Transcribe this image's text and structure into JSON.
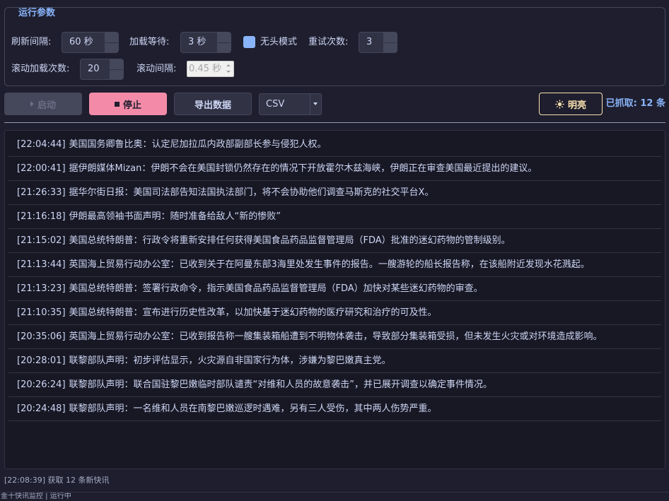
{
  "params": {
    "title": "运行参数",
    "refresh_interval": {
      "label": "刷新间隔:",
      "value": "60 秒"
    },
    "load_wait": {
      "label": "加载等待:",
      "value": "3 秒"
    },
    "headless": {
      "label": "无头模式",
      "checked": true
    },
    "retry_count": {
      "label": "重试次数:",
      "value": "3"
    },
    "scroll_load_count": {
      "label": "滚动加载次数:",
      "value": "20"
    },
    "scroll_interval": {
      "label": "滚动间隔:",
      "value": "0.45 秒",
      "enabled": false
    }
  },
  "toolbar": {
    "start": {
      "label": "启动",
      "icon": "play-icon",
      "enabled": false
    },
    "stop": {
      "label": "停止",
      "icon": "stop-icon",
      "enabled": true
    },
    "export": {
      "label": "导出数据",
      "enabled": true
    },
    "format": {
      "selected": "CSV",
      "icon": "chevron-down-icon"
    },
    "theme": {
      "label": "明亮",
      "icon": "sun-icon"
    },
    "count_label": "已抓取: 12 条"
  },
  "log": {
    "entries": [
      {
        "time": "[22:04:44]",
        "text": "美国国务卿鲁比奥：认定尼加拉瓜内政部副部长参与侵犯人权。"
      },
      {
        "time": "[22:00:41]",
        "text": "据伊朗媒体Mizan：伊朗不会在美国封锁仍然存在的情况下开放霍尔木兹海峡，伊朗正在审查美国最近提出的建议。"
      },
      {
        "time": "[21:26:33]",
        "text": "据华尔街日报：美国司法部告知法国执法部门，将不会协助他们调查马斯克的社交平台X。"
      },
      {
        "time": "[21:16:18]",
        "text": "伊朗最高领袖书面声明：随时准备给敌人“新的惨败”"
      },
      {
        "time": "[21:15:02]",
        "text": "美国总统特朗普：行政令将重新安排任何获得美国食品药品监督管理局（FDA）批准的迷幻药物的管制级别。"
      },
      {
        "time": "[21:13:44]",
        "text": "英国海上贸易行动办公室：已收到关于在阿曼东部3海里处发生事件的报告。一艘游轮的船长报告称，在该船附近发现水花溅起。"
      },
      {
        "time": "[21:13:23]",
        "text": "美国总统特朗普：签署行政命令，指示美国食品药品监督管理局（FDA）加快对某些迷幻药物的审查。"
      },
      {
        "time": "[21:10:35]",
        "text": "美国总统特朗普：宣布进行历史性改革，以加快基于迷幻药物的医疗研究和治疗的可及性。"
      },
      {
        "time": "[20:35:06]",
        "text": "英国海上贸易行动办公室：已收到报告称一艘集装箱船遭到不明物体袭击，导致部分集装箱受损，但未发生火灾或对环境造成影响。"
      },
      {
        "time": "[20:28:01]",
        "text": "联黎部队声明：初步评估显示，火灾源自非国家行为体，涉嫌为黎巴嫩真主党。"
      },
      {
        "time": "[20:26:24]",
        "text": "联黎部队声明：联合国驻黎巴嫩临时部队谴责“对维和人员的故意袭击”，并已展开调查以确定事件情况。"
      },
      {
        "time": "[20:24:48]",
        "text": "联黎部队声明：一名维和人员在南黎巴嫩巡逻时遇难，另有三人受伤，其中两人伤势严重。"
      }
    ]
  },
  "status_message": "[22:08:39] 获取 12 条新快讯",
  "status_bar": "金十快讯监控 | 运行中",
  "colors": {
    "bg": "#1e1e2e",
    "log_bg": "#181825",
    "surface": "#313244",
    "border": "#45475a",
    "text": "#cdd6f4",
    "subtext": "#a6adc8",
    "accent": "#89b4fa",
    "stop": "#f38ba8",
    "theme": "#f9e2af",
    "disabled_text": "#6c7086"
  }
}
